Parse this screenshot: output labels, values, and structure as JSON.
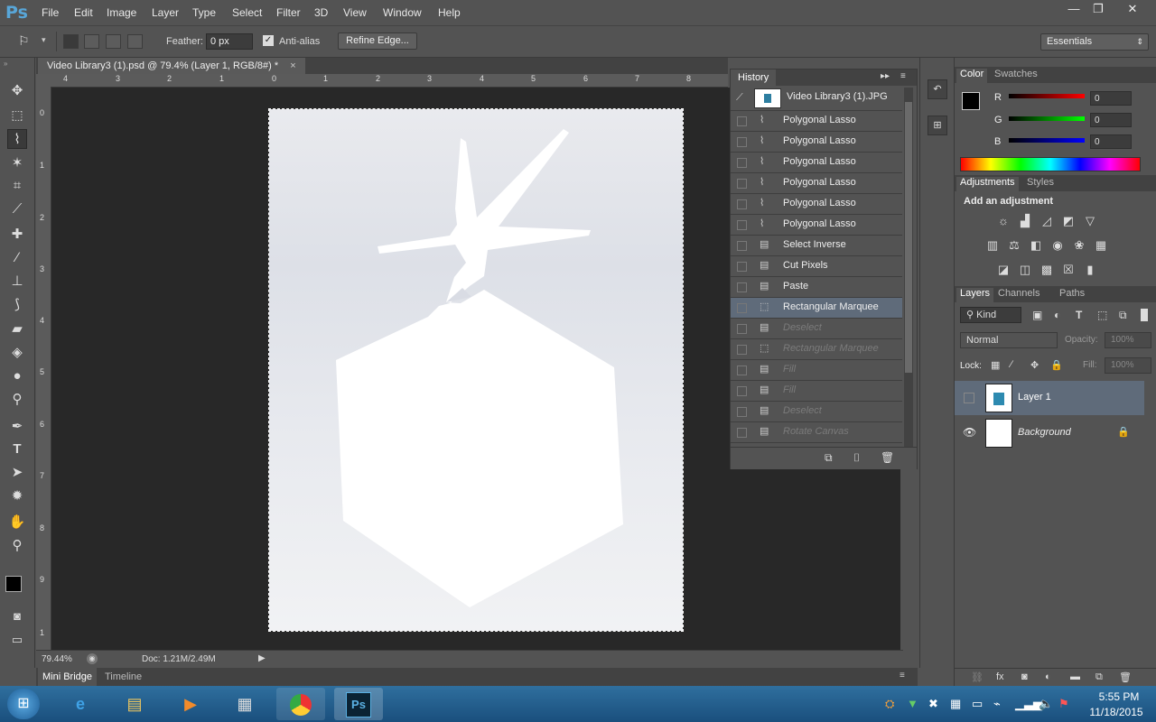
{
  "app": {
    "logo": "Ps"
  },
  "menu": [
    "File",
    "Edit",
    "Image",
    "Layer",
    "Type",
    "Select",
    "Filter",
    "3D",
    "View",
    "Window",
    "Help"
  ],
  "window_controls": {
    "minimize": "—",
    "restore": "❐",
    "close": "✕"
  },
  "options": {
    "feather_label": "Feather:",
    "feather_value": "0 px",
    "antialias_label": "Anti-alias",
    "refine_label": "Refine Edge...",
    "workspace": "Essentials"
  },
  "document": {
    "tab_title": "Video Library3 (1).psd @ 79.4% (Layer 1, RGB/8#) *",
    "tab_close": "×",
    "zoom": "79.44%",
    "doc_size": "Doc: 1.21M/2.49M"
  },
  "rulers": {
    "top": [
      "4",
      "3",
      "2",
      "1",
      "0",
      "1",
      "2",
      "3",
      "4",
      "5",
      "6",
      "7",
      "8"
    ],
    "left": [
      "0",
      "1",
      "2",
      "3",
      "4",
      "5",
      "6",
      "7",
      "8",
      "9",
      "1"
    ]
  },
  "bottom_tabs": {
    "mini_bridge": "Mini Bridge",
    "timeline": "Timeline"
  },
  "history": {
    "title": "History",
    "snapshot": "Video Library3 (1).JPG",
    "items": [
      {
        "label": "Polygonal Lasso"
      },
      {
        "label": "Polygonal Lasso"
      },
      {
        "label": "Polygonal Lasso"
      },
      {
        "label": "Polygonal Lasso"
      },
      {
        "label": "Polygonal Lasso"
      },
      {
        "label": "Polygonal Lasso"
      },
      {
        "label": "Select Inverse"
      },
      {
        "label": "Cut Pixels"
      },
      {
        "label": "Paste"
      },
      {
        "label": "Rectangular Marquee"
      },
      {
        "label": "Deselect"
      },
      {
        "label": "Rectangular Marquee"
      },
      {
        "label": "Fill"
      },
      {
        "label": "Fill"
      },
      {
        "label": "Deselect"
      },
      {
        "label": "Rotate Canvas"
      }
    ]
  },
  "color_panel": {
    "tabs": [
      "Color",
      "Swatches"
    ],
    "r_label": "R",
    "g_label": "G",
    "b_label": "B",
    "r": "0",
    "g": "0",
    "b": "0"
  },
  "adjust_panel": {
    "tabs": [
      "Adjustments",
      "Styles"
    ],
    "heading": "Add an adjustment"
  },
  "layers_panel": {
    "tabs": [
      "Layers",
      "Channels",
      "Paths"
    ],
    "kind": "Kind",
    "blend": "Normal",
    "opacity_label": "Opacity:",
    "opacity": "100%",
    "lock_label": "Lock:",
    "fill_label": "Fill:",
    "fill": "100%",
    "layers": [
      {
        "name": "Layer 1"
      },
      {
        "name": "Background"
      }
    ]
  },
  "clock": {
    "time": "5:55 PM",
    "date": "11/18/2015"
  }
}
